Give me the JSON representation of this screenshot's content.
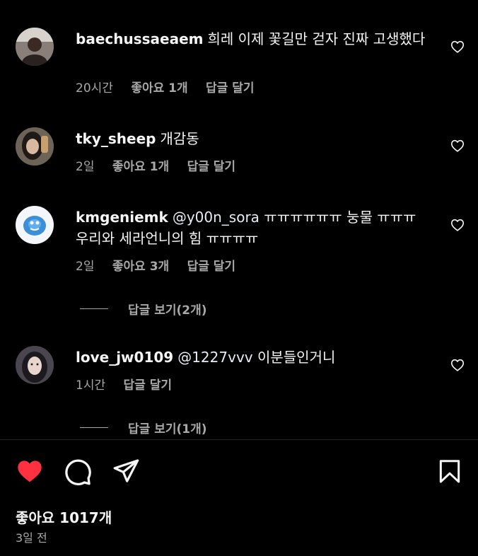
{
  "comments": [
    {
      "username": "baechussaeaem",
      "text": "희레 이제 꽃길만 걷자 진짜 고생했다",
      "time": "20시간",
      "likes": "좋아요 1개",
      "reply": "답글 달기"
    },
    {
      "username": "tky_sheep",
      "text": "개감동",
      "time": "2일",
      "likes": "좋아요 1개",
      "reply": "답글 달기"
    },
    {
      "username": "kmgeniemk",
      "mention": "@y00n_sora",
      "text": "ㅠㅠㅠㅠㅠㅠ 눙물 ㅠㅠㅠ 우리와 세라언니의 힘 ㅠㅠㅠㅠ",
      "time": "2일",
      "likes": "좋아요 3개",
      "reply": "답글 달기",
      "view_replies": "답글 보기(2개)"
    },
    {
      "username": "love_jw0109",
      "mention": "@1227vvv",
      "text": "이분들인거니",
      "time": "1시간",
      "reply": "답글 달기",
      "view_replies": "답글 보기(1개)"
    }
  ],
  "post": {
    "likes": "좋아요 1017개",
    "date": "3일 전",
    "liked": true
  },
  "icons": {
    "like": "heart-filled-icon",
    "comment": "comment-bubble-icon",
    "share": "paper-plane-icon",
    "save": "bookmark-icon",
    "comment_like": "heart-outline-icon"
  },
  "colors": {
    "background": "#000000",
    "text": "#f5f5f5",
    "secondary": "#a8a8a8",
    "like_red": "#ff3040"
  }
}
